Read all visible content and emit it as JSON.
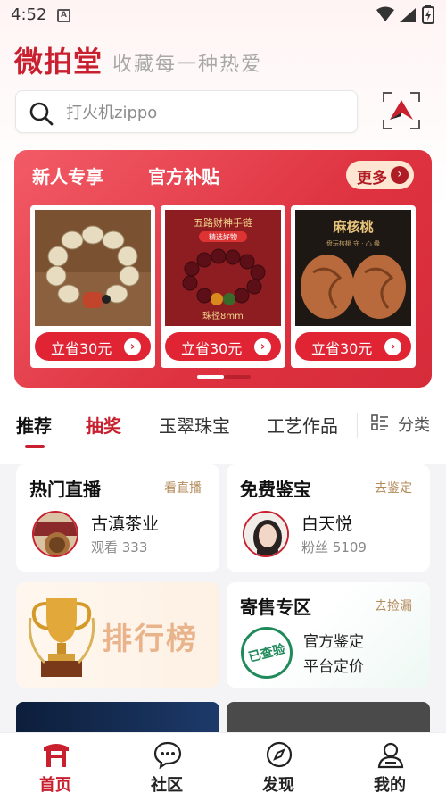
{
  "status_bar": {
    "time": "4:52",
    "notification_icon": "A"
  },
  "header": {
    "brand": "微拍堂",
    "slogan": "收藏每一种热爱"
  },
  "search": {
    "placeholder": "打火机zippo"
  },
  "promo": {
    "title": "新人专享",
    "subtitle": "官方补贴",
    "more_label": "更多",
    "products": [
      {
        "image": "bodhi-bracelet",
        "button": "立省30元"
      },
      {
        "image": "red-bead-bracelet",
        "button": "立省30元",
        "image_title": "五路财神手链",
        "image_tag": "精选好物",
        "image_caption": "珠径8mm"
      },
      {
        "image": "walnut-carving",
        "button": "立省30元",
        "image_title": "麻核桃",
        "image_caption": "盘玩核桃 守 · 心 缘"
      }
    ]
  },
  "tabs": {
    "items": [
      {
        "label": "推荐"
      },
      {
        "label": "抽奖"
      },
      {
        "label": "玉翠珠宝"
      },
      {
        "label": "工艺作品"
      }
    ],
    "category_label": "分类"
  },
  "cards": {
    "live": {
      "title": "热门直播",
      "link": "看直播",
      "name": "古滇茶业",
      "meta": "观看 333"
    },
    "appraise": {
      "title": "免费鉴宝",
      "link": "去鉴定",
      "name": "白天悦",
      "meta": "粉丝 5109"
    },
    "ranking": {
      "label": "排行榜"
    },
    "consign": {
      "title": "寄售专区",
      "link": "去捡漏",
      "line1": "官方鉴定",
      "line2": "平台定价",
      "stamp": "已查验"
    }
  },
  "bottom_nav": [
    {
      "label": "首页",
      "icon": "home-gate-icon",
      "active": true
    },
    {
      "label": "社区",
      "icon": "chat-bubble-icon"
    },
    {
      "label": "发现",
      "icon": "compass-icon"
    },
    {
      "label": "我的",
      "icon": "profile-icon"
    }
  ],
  "colors": {
    "brand_red": "#c8202e",
    "gold": "#b48a5a",
    "green_stamp": "#1f8a5a"
  }
}
